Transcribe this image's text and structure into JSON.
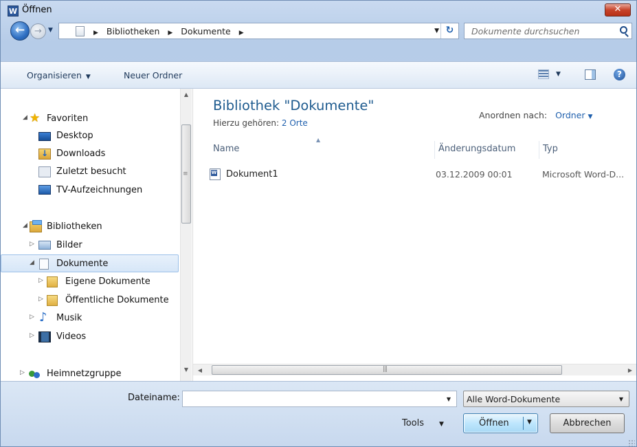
{
  "window": {
    "title": "Öffnen",
    "app_icon_letter": "W",
    "close_glyph": "✕"
  },
  "address_bar": {
    "crumbs": [
      "Bibliotheken",
      "Dokumente"
    ],
    "back_glyph": "←",
    "forward_glyph": "→",
    "refresh_glyph": "↻"
  },
  "search": {
    "placeholder": "Dokumente durchsuchen"
  },
  "toolbar": {
    "organize_label": "Organisieren",
    "new_folder_label": "Neuer Ordner",
    "help_glyph": "?"
  },
  "nav": {
    "favorites": {
      "label": "Favoriten",
      "items": [
        "Desktop",
        "Downloads",
        "Zuletzt besucht",
        "TV-Aufzeichnungen"
      ]
    },
    "libraries": {
      "label": "Bibliotheken",
      "items": {
        "pictures": "Bilder",
        "documents": "Dokumente",
        "my_documents": "Eigene Dokumente",
        "public_documents": "Öffentliche Dokumente",
        "music": "Musik",
        "videos": "Videos"
      }
    },
    "homegroup": "Heimnetzgruppe",
    "selected": "Dokumente"
  },
  "library": {
    "title": "Bibliothek \"Dokumente\"",
    "includes_label": "Hierzu gehören:",
    "includes_link": "2 Orte",
    "arrange_label": "Anordnen nach:",
    "arrange_value": "Ordner"
  },
  "columns": [
    "Name",
    "Änderungsdatum",
    "Typ"
  ],
  "files": [
    {
      "name": "Dokument1",
      "date": "03.12.2009 00:01",
      "type": "Microsoft Word-D..."
    }
  ],
  "footer": {
    "filename_label": "Dateiname:",
    "filename_value": "",
    "filetype_selected": "Alle Word-Dokumente",
    "tools_label": "Tools",
    "open_label": "Öffnen",
    "cancel_label": "Abbrechen"
  },
  "colors": {
    "accent": "#1e5b8f",
    "link": "#1e5fad",
    "close": "#c7432a"
  }
}
